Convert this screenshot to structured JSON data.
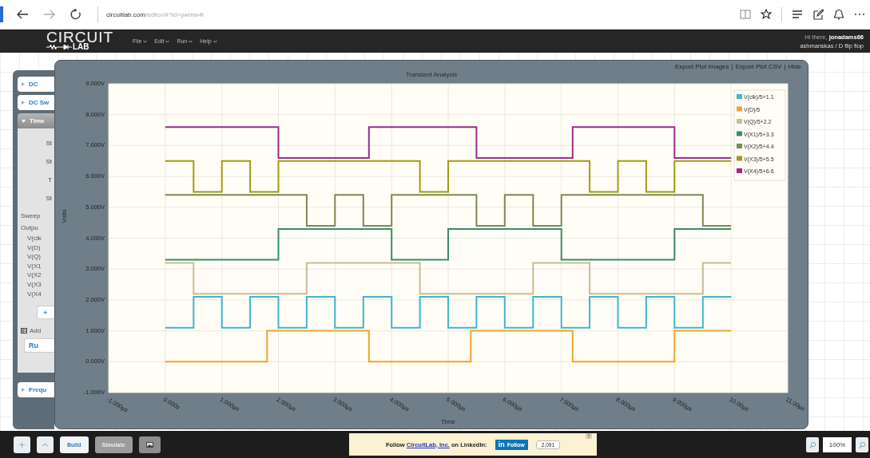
{
  "browser": {
    "url_host": "circuitlab.com",
    "url_path": "/editor/#?id=ywmw4t"
  },
  "app_header": {
    "logo_top": "CIRCUIT",
    "logo_bottom": "LAB",
    "menus": [
      {
        "label": "File"
      },
      {
        "label": "Edit"
      },
      {
        "label": "Run"
      },
      {
        "label": "Help"
      }
    ],
    "greeting": "Hi there, **jonadams66**",
    "circuit_path": "ashmanskas / D flip flop"
  },
  "left_panel": {
    "sections": [
      {
        "label": "DC",
        "expanded": false,
        "selected": false
      },
      {
        "label": "DC Sw",
        "expanded": false,
        "selected": false
      },
      {
        "label": "Time",
        "expanded": true,
        "selected": true,
        "body": {
          "fields": [
            "St",
            "St",
            "T",
            "St"
          ],
          "sweep_label": "Sweep",
          "output_label": "Outpu",
          "outputs": [
            "V(clk",
            "V(D)",
            "V(Q)",
            "V(X1",
            "V(X2",
            "V(X3",
            "V(X4"
          ],
          "add_button": "+",
          "add_label": "Add",
          "run_button": "Ru"
        }
      },
      {
        "label": "Frequ",
        "expanded": false,
        "selected": false
      }
    ]
  },
  "chart_panel": {
    "links": [
      "Export Plot Images",
      "Export Plot CSV",
      "Hide"
    ],
    "link_separator": "|",
    "chart_data": {
      "type": "line",
      "title": "Transient Analysis",
      "xlabel": "Time",
      "ylabel": "Volts",
      "x": [
        0,
        0.5,
        0.5,
        1,
        1,
        1.5,
        1.5,
        1.8,
        1.8,
        2,
        2,
        2.5,
        2.5,
        3,
        3,
        3.5,
        3.5,
        3.6,
        3.6,
        4,
        4,
        4.5,
        4.5,
        5,
        5,
        5.4,
        5.4,
        5.5,
        5.5,
        6,
        6,
        6.5,
        6.5,
        7,
        7,
        7.2,
        7.2,
        7.5,
        7.5,
        8,
        8,
        8.5,
        8.5,
        9,
        9,
        9.5,
        9.5,
        10
      ],
      "series": [
        {
          "name": "V(clk)/5+1.1",
          "color": "#3fb6c9",
          "values": [
            1.1,
            1.1,
            2.1,
            2.1,
            1.1,
            1.1,
            2.1,
            2.1,
            2.1,
            2.1,
            1.1,
            1.1,
            2.1,
            2.1,
            1.1,
            1.1,
            2.1,
            2.1,
            2.1,
            2.1,
            1.1,
            1.1,
            2.1,
            2.1,
            1.1,
            1.1,
            1.1,
            1.1,
            2.1,
            2.1,
            1.1,
            1.1,
            2.1,
            2.1,
            1.1,
            1.1,
            1.1,
            1.1,
            2.1,
            2.1,
            1.1,
            1.1,
            2.1,
            2.1,
            1.1,
            1.1,
            2.1,
            2.1
          ]
        },
        {
          "name": "V(D)/5",
          "color": "#eea52e",
          "values": [
            0,
            0,
            0,
            0,
            0,
            0,
            0,
            0,
            1,
            1,
            1,
            1,
            1,
            1,
            1,
            1,
            1,
            1,
            0,
            0,
            0,
            0,
            0,
            0,
            0,
            0,
            1,
            1,
            1,
            1,
            1,
            1,
            1,
            1,
            1,
            1,
            0,
            0,
            0,
            0,
            0,
            0,
            0,
            0,
            1,
            1,
            1,
            1
          ]
        },
        {
          "name": "V(Q)/5+2.2",
          "color": "#c9bb93",
          "values": [
            3.2,
            3.2,
            2.2,
            2.2,
            2.2,
            2.2,
            2.2,
            2.2,
            2.2,
            2.2,
            2.2,
            2.2,
            3.2,
            3.2,
            3.2,
            3.2,
            3.2,
            3.2,
            3.2,
            3.2,
            3.2,
            3.2,
            2.2,
            2.2,
            2.2,
            2.2,
            2.2,
            2.2,
            2.2,
            2.2,
            2.2,
            2.2,
            3.2,
            3.2,
            3.2,
            3.2,
            3.2,
            3.2,
            2.2,
            2.2,
            2.2,
            2.2,
            2.2,
            2.2,
            2.2,
            2.2,
            3.2,
            3.2
          ]
        },
        {
          "name": "V(X1)/5+3.3",
          "color": "#3b8c6c",
          "values": [
            3.3,
            3.3,
            3.3,
            3.3,
            3.3,
            3.3,
            3.3,
            3.3,
            3.3,
            3.3,
            4.3,
            4.3,
            4.3,
            4.3,
            4.3,
            4.3,
            4.3,
            4.3,
            4.3,
            4.3,
            3.3,
            3.3,
            3.3,
            3.3,
            4.3,
            4.3,
            4.3,
            4.3,
            4.3,
            4.3,
            4.3,
            4.3,
            4.3,
            4.3,
            3.3,
            3.3,
            3.3,
            3.3,
            3.3,
            3.3,
            3.3,
            3.3,
            3.3,
            3.3,
            4.3,
            4.3,
            4.3,
            4.3
          ]
        },
        {
          "name": "V(X2)/5+4.4",
          "color": "#7b8a52",
          "values": [
            5.4,
            5.4,
            5.4,
            5.4,
            5.4,
            5.4,
            5.4,
            5.4,
            5.4,
            5.4,
            5.4,
            5.4,
            4.4,
            4.4,
            5.4,
            5.4,
            4.4,
            4.4,
            4.4,
            4.4,
            5.4,
            5.4,
            5.4,
            5.4,
            5.4,
            5.4,
            5.4,
            5.4,
            4.4,
            4.4,
            5.4,
            5.4,
            4.4,
            4.4,
            5.4,
            5.4,
            5.4,
            5.4,
            5.4,
            5.4,
            5.4,
            5.4,
            5.4,
            5.4,
            5.4,
            5.4,
            4.4,
            4.4
          ]
        },
        {
          "name": "V(X3)/5+5.5",
          "color": "#a29b12",
          "values": [
            6.5,
            6.5,
            5.5,
            5.5,
            6.5,
            6.5,
            5.5,
            5.5,
            5.5,
            5.5,
            6.5,
            6.5,
            6.5,
            6.5,
            6.5,
            6.5,
            6.5,
            6.5,
            6.5,
            6.5,
            6.5,
            6.5,
            5.5,
            5.5,
            6.5,
            6.5,
            6.5,
            6.5,
            6.5,
            6.5,
            6.5,
            6.5,
            6.5,
            6.5,
            6.5,
            6.5,
            6.5,
            6.5,
            5.5,
            5.5,
            6.5,
            6.5,
            5.5,
            5.5,
            6.5,
            6.5,
            6.5,
            6.5
          ]
        },
        {
          "name": "V(X4)/5+6.6",
          "color": "#9b2b8b",
          "values": [
            7.6,
            7.6,
            7.6,
            7.6,
            7.6,
            7.6,
            7.6,
            7.6,
            7.6,
            7.6,
            6.6,
            6.6,
            6.6,
            6.6,
            6.6,
            6.6,
            6.6,
            6.6,
            7.6,
            7.6,
            7.6,
            7.6,
            7.6,
            7.6,
            7.6,
            7.6,
            7.6,
            7.6,
            6.6,
            6.6,
            6.6,
            6.6,
            6.6,
            6.6,
            6.6,
            6.6,
            7.6,
            7.6,
            7.6,
            7.6,
            7.6,
            7.6,
            7.6,
            7.6,
            6.6,
            6.6,
            6.6,
            6.6
          ]
        }
      ],
      "xlim": [
        -1,
        11
      ],
      "ylim": [
        -1,
        9
      ],
      "grid": true,
      "legend": true,
      "xticks": [
        {
          "value": -1,
          "label": "-1.000µs"
        },
        {
          "value": 0,
          "label": "0.000s"
        },
        {
          "value": 1,
          "label": "1.000µs"
        },
        {
          "value": 2,
          "label": "2.000µs"
        },
        {
          "value": 3,
          "label": "3.000µs"
        },
        {
          "value": 4,
          "label": "4.000µs"
        },
        {
          "value": 5,
          "label": "5.000µs"
        },
        {
          "value": 6,
          "label": "6.000µs"
        },
        {
          "value": 7,
          "label": "7.000µs"
        },
        {
          "value": 8,
          "label": "8.000µs"
        },
        {
          "value": 9,
          "label": "9.000µs"
        },
        {
          "value": 10,
          "label": "10.00µs"
        },
        {
          "value": 11,
          "label": "11.00µs"
        }
      ],
      "yticks": [
        {
          "value": -1,
          "label": "-1.000V"
        },
        {
          "value": 0,
          "label": "0.000V"
        },
        {
          "value": 1,
          "label": "1.000V"
        },
        {
          "value": 2,
          "label": "2.000V"
        },
        {
          "value": 3,
          "label": "3.000V"
        },
        {
          "value": 4,
          "label": "4.000V"
        },
        {
          "value": 5,
          "label": "5.000V"
        },
        {
          "value": 6,
          "label": "6.000V"
        },
        {
          "value": 7,
          "label": "7.000V"
        },
        {
          "value": 8,
          "label": "8.000V"
        },
        {
          "value": 9,
          "label": "9.000V"
        }
      ]
    }
  },
  "bottom_bar": {
    "mode_tabs": [
      {
        "label": "Build",
        "selected": true
      },
      {
        "label": "Simulate",
        "selected": false
      }
    ],
    "linkedin": {
      "text_before": "Follow ",
      "company": "CircuitLab, Inc.",
      "text_after": " on LinkedIn:",
      "in_logo": "in",
      "follow_label": "Follow",
      "count": "2,091",
      "help": "?"
    },
    "zoom_level": "100%"
  }
}
